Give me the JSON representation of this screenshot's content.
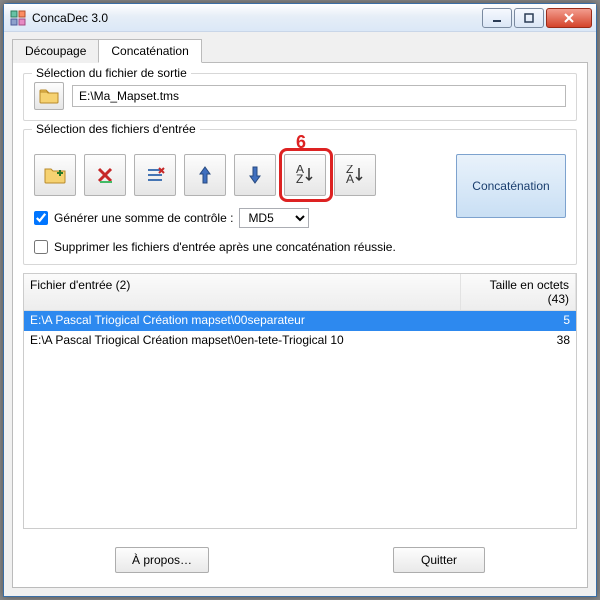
{
  "window": {
    "title": "ConcaDec 3.0"
  },
  "tabs": {
    "decoupage": "Découpage",
    "concat": "Concaténation"
  },
  "output": {
    "group_title": "Sélection du fichier de sortie",
    "path": "E:\\Ma_Mapset.tms"
  },
  "input": {
    "group_title": "Sélection des fichiers d'entrée",
    "annotation": "6",
    "checksum_label": "Générer une somme de contrôle :",
    "checksum_value": "MD5",
    "delete_after_label": "Supprimer les fichiers d'entrée après une concaténation réussie."
  },
  "action": {
    "concat_label": "Concaténation"
  },
  "list": {
    "header_path": "Fichier d'entrée (2)",
    "header_size": "Taille en octets (43)",
    "rows": [
      {
        "path": "E:\\A Pascal Triogical Création mapset\\00separateur",
        "size": "5"
      },
      {
        "path": "E:\\A Pascal Triogical Création mapset\\0en-tete-Triogical 10",
        "size": "38"
      }
    ]
  },
  "footer": {
    "about": "À propos…",
    "quit": "Quitter"
  }
}
